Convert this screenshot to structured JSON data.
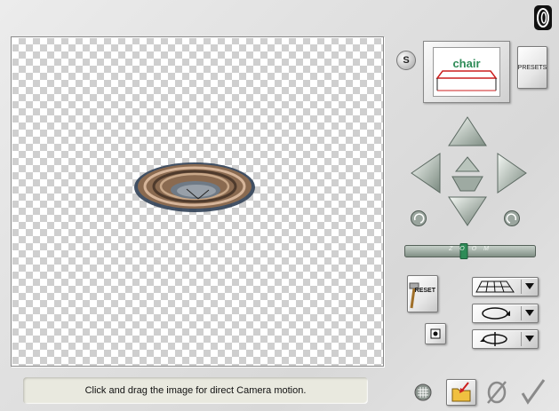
{
  "canvas": {
    "object": "torus",
    "background": "transparent-checkerboard"
  },
  "status_text": "Click and drag the image for direct Camera motion.",
  "logo": {
    "icon": "app-logo-icon"
  },
  "s_button": {
    "label": "S"
  },
  "preview": {
    "text": "chair"
  },
  "presets": {
    "label": "PRESETS"
  },
  "nav": {
    "up": "arrow-up-icon",
    "down": "arrow-down-icon",
    "left": "arrow-left-icon",
    "right": "arrow-right-icon",
    "center_up": "nudge-up-icon",
    "center_down": "nudge-down-icon",
    "rotate_left": "rotate-left-icon",
    "rotate_right": "rotate-right-icon"
  },
  "zoom": {
    "label": "Z O O M",
    "level": 0.45
  },
  "reset": {
    "label": "RESET"
  },
  "colors": {
    "accent_green": "#2e8b57",
    "preview_red": "#cc1f1f",
    "torus": "#7a5c44"
  }
}
